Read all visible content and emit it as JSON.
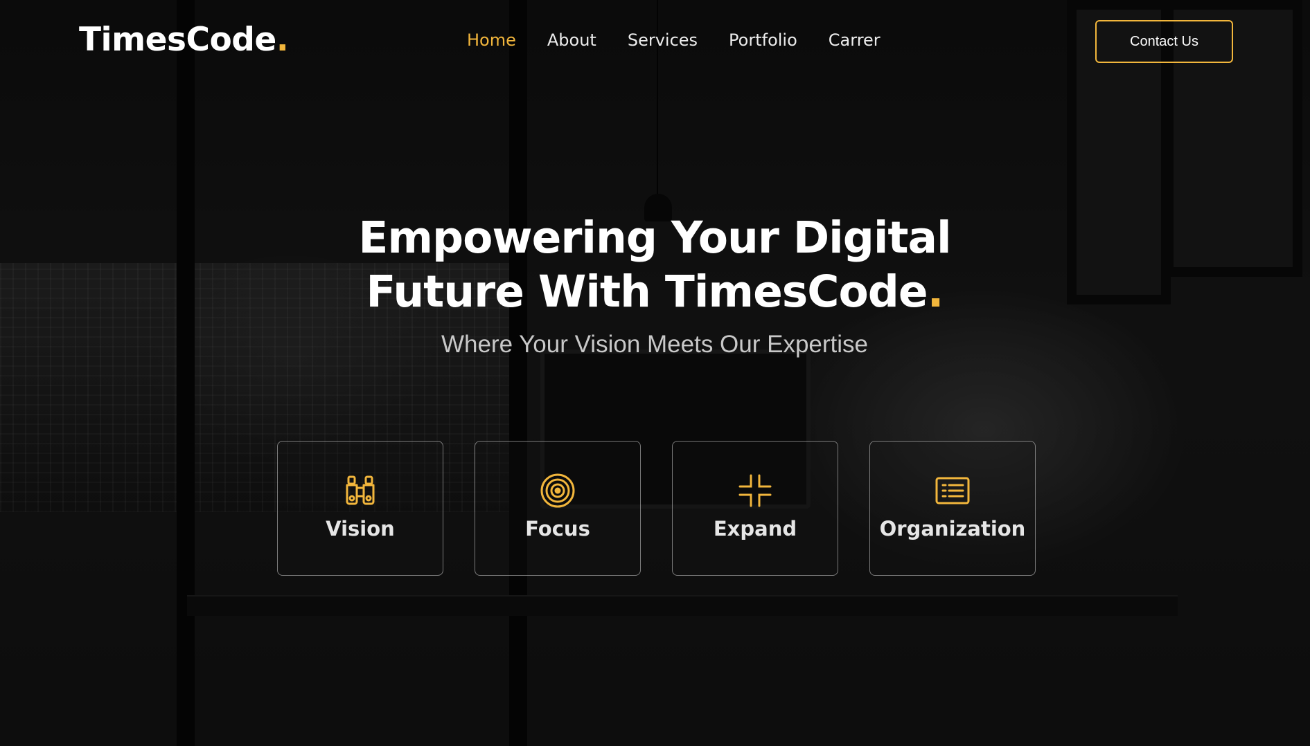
{
  "brand": {
    "name": "TimesCode",
    "dot": ".",
    "accent_color": "#f2b63c"
  },
  "nav": {
    "items": [
      {
        "label": "Home",
        "active": true
      },
      {
        "label": "About",
        "active": false
      },
      {
        "label": "Services",
        "active": false
      },
      {
        "label": "Portfolio",
        "active": false
      },
      {
        "label": "Carrer",
        "active": false
      }
    ]
  },
  "header": {
    "contact_label": "Contact Us"
  },
  "hero": {
    "title_line1": "Empowering Your Digital",
    "title_line2": "Future With TimesCode",
    "title_dot": ".",
    "subtitle": "Where Your Vision Meets Our Expertise"
  },
  "features": [
    {
      "label": "Vision",
      "icon": "binoculars-icon"
    },
    {
      "label": "Focus",
      "icon": "target-icon"
    },
    {
      "label": "Expand",
      "icon": "expand-icon"
    },
    {
      "label": "Organization",
      "icon": "list-icon"
    }
  ]
}
